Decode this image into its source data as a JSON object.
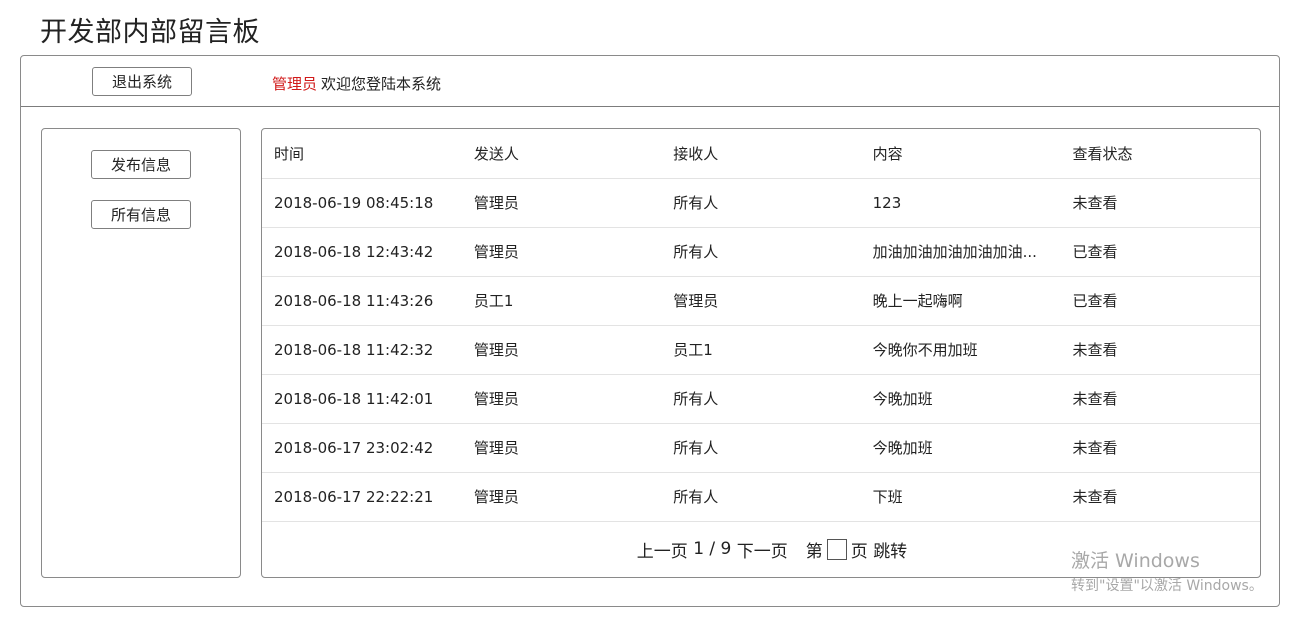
{
  "app": {
    "title": "开发部内部留言板"
  },
  "topbar": {
    "logout_label": "退出系统",
    "role": "管理员",
    "welcome_text": "欢迎您登陆本系统"
  },
  "sidebar": {
    "publish_label": "发布信息",
    "all_label": "所有信息"
  },
  "table": {
    "headers": [
      "时间",
      "发送人",
      "接收人",
      "内容",
      "查看状态"
    ],
    "rows": [
      [
        "2018-06-19 08:45:18",
        "管理员",
        "所有人",
        "123",
        "未查看"
      ],
      [
        "2018-06-18 12:43:42",
        "管理员",
        "所有人",
        "加油加油加油加油加油...",
        "已查看"
      ],
      [
        "2018-06-18 11:43:26",
        "员工1",
        "管理员",
        "晚上一起嗨啊",
        "已查看"
      ],
      [
        "2018-06-18 11:42:32",
        "管理员",
        "员工1",
        "今晚你不用加班",
        "未查看"
      ],
      [
        "2018-06-18 11:42:01",
        "管理员",
        "所有人",
        "今晚加班",
        "未查看"
      ],
      [
        "2018-06-17 23:02:42",
        "管理员",
        "所有人",
        "今晚加班",
        "未查看"
      ],
      [
        "2018-06-17 22:22:21",
        "管理员",
        "所有人",
        "下班",
        "未查看"
      ]
    ]
  },
  "pager": {
    "prev_label": "上一页",
    "page_info": "1 / 9",
    "next_label": "下一页",
    "goto_prefix": "第",
    "goto_suffix": "页",
    "jump_label": "跳转",
    "input_value": ""
  },
  "watermark": {
    "line1": "激活 Windows",
    "line2": "转到\"设置\"以激活 Windows。"
  }
}
